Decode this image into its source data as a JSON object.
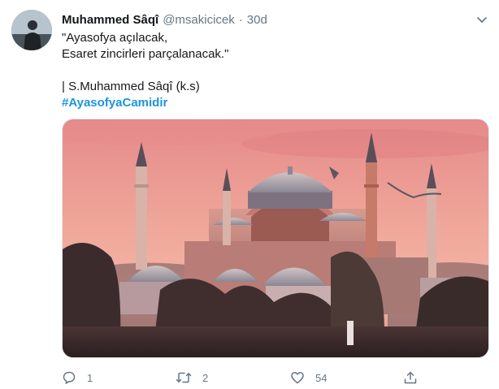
{
  "tweet": {
    "display_name": "Muhammed Sâqî",
    "handle": "@msakicicek",
    "separator": "·",
    "time": "30d",
    "lines": [
      "\"Ayasofya açılacak,",
      "Esaret zincirleri parçalanacak.\""
    ],
    "attribution": "| S.Muhammed Sâqî (k.s)",
    "hashtag": "#AyasofyaCamidir"
  },
  "actions": {
    "reply_count": "1",
    "retweet_count": "2",
    "like_count": "54"
  },
  "icons": {
    "reply": "reply-icon",
    "retweet": "retweet-icon",
    "like": "heart-icon",
    "share": "share-icon",
    "caret": "chevron-down-icon"
  },
  "colors": {
    "text": "#14171a",
    "secondary": "#657786",
    "link": "#1b95e0"
  }
}
